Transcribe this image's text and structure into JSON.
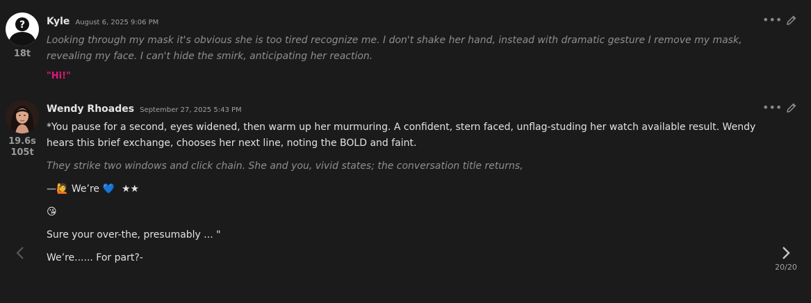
{
  "messages": [
    {
      "author": "Kyle",
      "timestamp": "August 6, 2025 9:06 PM",
      "stats": [
        "18t"
      ],
      "avatar_icon": "person-silhouette-icon",
      "paragraphs": [
        {
          "style": "italic",
          "text": "Looking through my mask it's obvious she is too tired recognize me. I don't shake her hand, instead with dramatic gesture I remove my mask, revealing my face. I can't hide the smirk, anticipating her reaction."
        },
        {
          "style": "quote",
          "text": "\"Hi!\""
        }
      ]
    },
    {
      "author": "Wendy Rhoades",
      "timestamp": "September 27, 2025 5:43 PM",
      "stats": [
        "19.6s",
        "105t"
      ],
      "avatar_icon": "woman-portrait-avatar",
      "paragraphs": [
        {
          "style": "plain",
          "text": "*You pause for a second, eyes widened, then warm up her murmuring. A confident, stern faced, unflag-studing her watch available result. Wendy hears this brief exchange, chooses her next line, noting the BOLD and faint."
        },
        {
          "style": "italic",
          "text": "They strike two windows and click chain. She and you, vivid states; the conversation title returns,"
        },
        {
          "style": "plain",
          "prefix": "—🙋",
          "text": " We’re ",
          "heart": "💙",
          "stars": "★★"
        },
        {
          "style": "plain",
          "text": "😘"
        },
        {
          "style": "plain",
          "text": "Sure your over-the, presumably ... \""
        },
        {
          "style": "plain",
          "text": "We’re...... For part?-"
        }
      ]
    }
  ],
  "actions": {
    "more": "•••"
  },
  "pagination": {
    "label": "20/20"
  },
  "colors": {
    "background": "#1b1b1c",
    "quote": "#e0187a",
    "italic": "#8f8f8f",
    "accent_heart": "#3a8df0"
  }
}
